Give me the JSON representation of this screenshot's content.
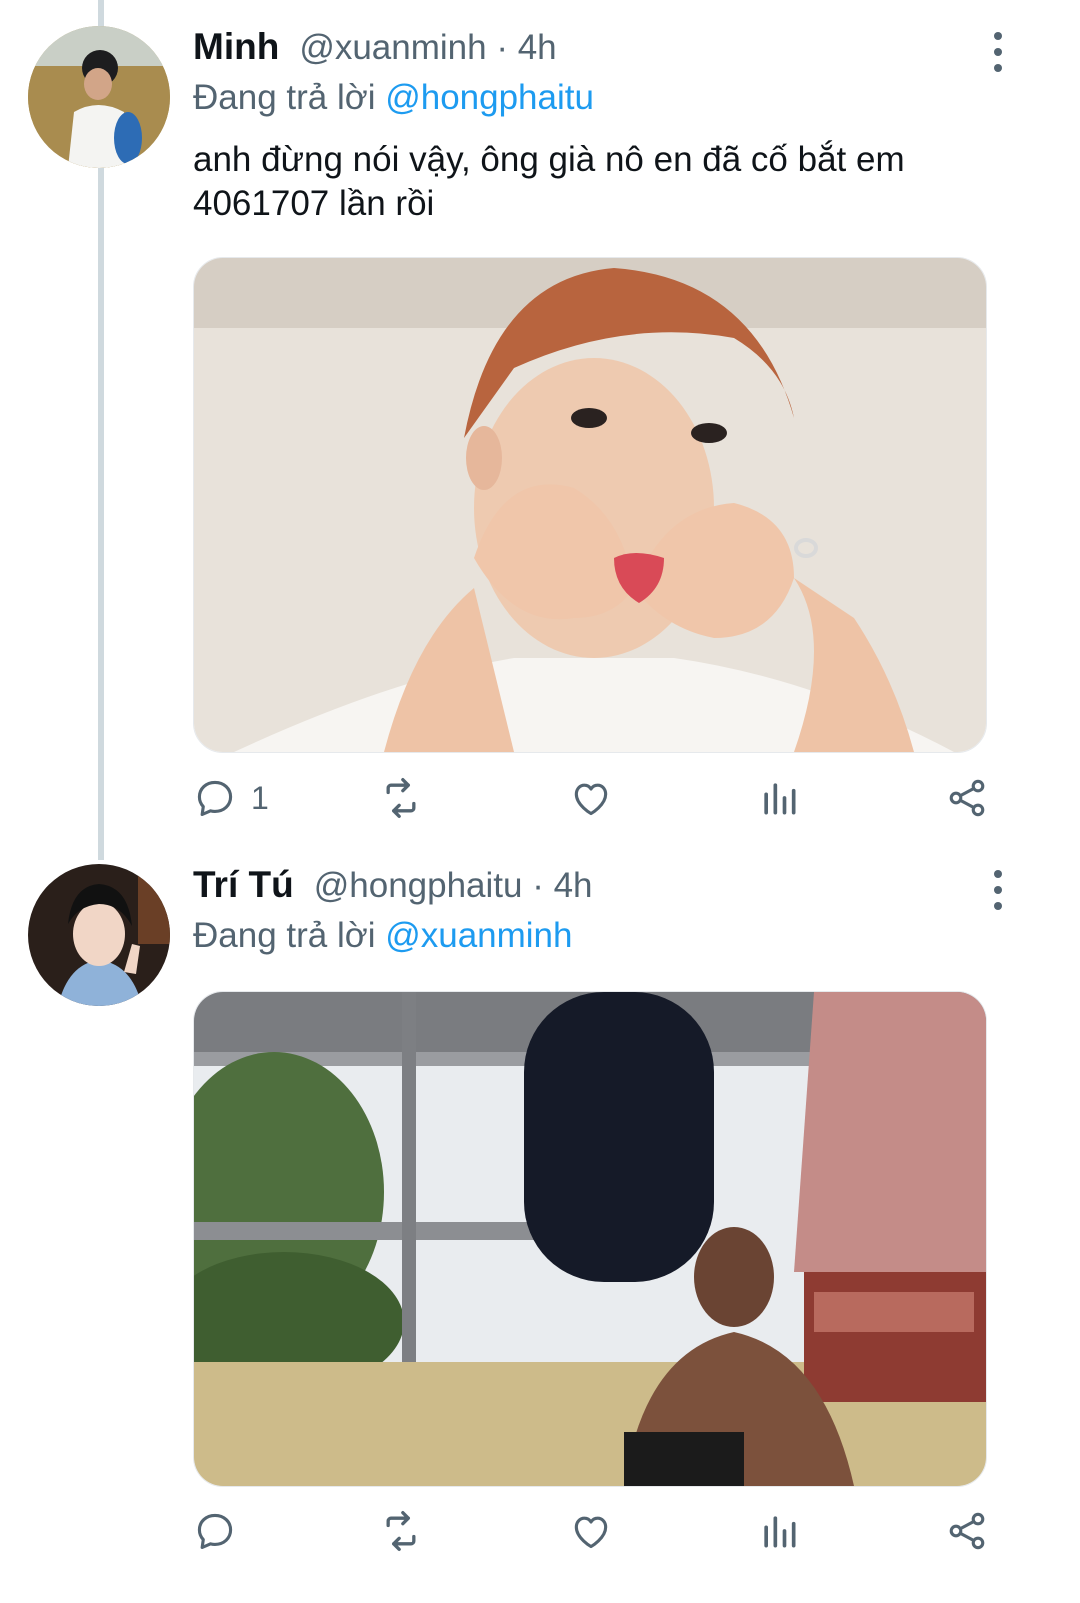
{
  "tweets": [
    {
      "name": "Minh",
      "meta": "@xuanminh · 4h",
      "replying_prefix": "Đang trả lời",
      "replying_to": "@hongphaitu",
      "text": "anh đừng nói vậy, ông già nô en đã cố bắt em 4061707 lần rồi",
      "reply_count": "1"
    },
    {
      "name": "Trí Tú",
      "meta": "@hongphaitu · 4h",
      "replying_prefix": "Đang trả lời",
      "replying_to": "@xuanminh",
      "text": "",
      "reply_count": ""
    }
  ],
  "icons": [
    "more-vertical-icon",
    "reply-icon",
    "retweet-icon",
    "like-icon",
    "analytics-icon",
    "share-icon"
  ],
  "colors": {
    "mention": "#1d9bf0",
    "secondary_text": "#536471",
    "primary_text": "#0f1419"
  }
}
